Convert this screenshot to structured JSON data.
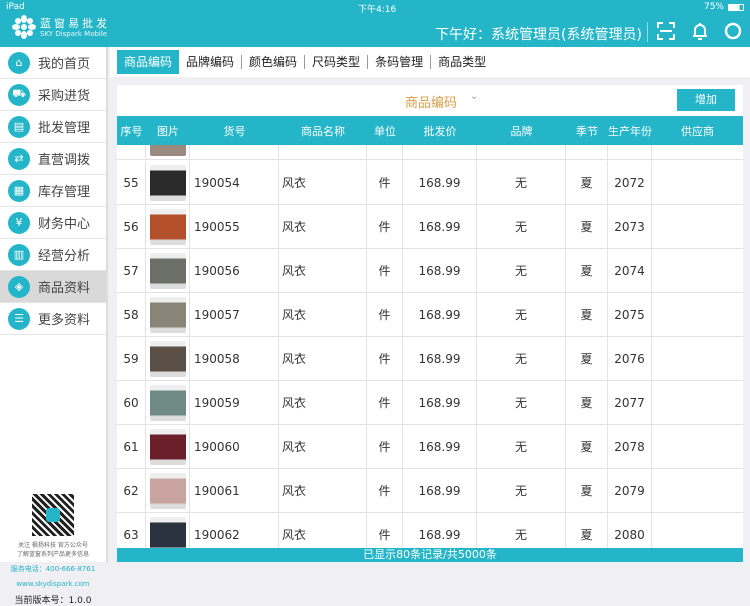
{
  "status_bar": {
    "device": "iPad",
    "time": "下午4:16",
    "battery": "75%"
  },
  "header": {
    "brand_cn": "蓝窗易批发",
    "brand_en": "SKY Dispark Mobile",
    "greeting": "下午好：系统管理员(系统管理员)"
  },
  "sidebar": {
    "items": [
      {
        "label": "我的首页",
        "icon": "home-icon"
      },
      {
        "label": "采购进货",
        "icon": "truck-icon"
      },
      {
        "label": "批发管理",
        "icon": "wholesale-icon"
      },
      {
        "label": "直营调拨",
        "icon": "transfer-icon"
      },
      {
        "label": "库存管理",
        "icon": "inventory-icon"
      },
      {
        "label": "财务中心",
        "icon": "yen-icon"
      },
      {
        "label": "经营分析",
        "icon": "chart-icon"
      },
      {
        "label": "商品资料",
        "icon": "bag-icon",
        "selected": true
      },
      {
        "label": "更多资料",
        "icon": "list-icon"
      }
    ],
    "follow": "关注 枫杨科技 官方公众号",
    "follow2": "了解蓝窗系列产品更多信息",
    "phone": "服务电话：400-666-8761",
    "website": "www.skydispark.com",
    "version": "当前版本号：1.0.0"
  },
  "tabs": [
    "商品编码",
    "品牌编码",
    "颜色编码",
    "尺码类型",
    "条码管理",
    "商品类型"
  ],
  "panel": {
    "title": "商品编码",
    "add_label": "增加"
  },
  "table": {
    "headers": [
      "序号",
      "图片",
      "货号",
      "商品名称",
      "单位",
      "批发价",
      "品牌",
      "季节",
      "生产年份",
      "供应商"
    ],
    "rows": [
      {
        "no": "55",
        "code": "190054",
        "name": "风衣",
        "unit": "件",
        "price": "168.99",
        "brand": "无",
        "season": "夏",
        "year": "2072",
        "supplier": "",
        "color": "#2a2a2a"
      },
      {
        "no": "56",
        "code": "190055",
        "name": "风衣",
        "unit": "件",
        "price": "168.99",
        "brand": "无",
        "season": "夏",
        "year": "2073",
        "supplier": "",
        "color": "#b4502c"
      },
      {
        "no": "57",
        "code": "190056",
        "name": "风衣",
        "unit": "件",
        "price": "168.99",
        "brand": "无",
        "season": "夏",
        "year": "2074",
        "supplier": "",
        "color": "#6d7068"
      },
      {
        "no": "58",
        "code": "190057",
        "name": "风衣",
        "unit": "件",
        "price": "168.99",
        "brand": "无",
        "season": "夏",
        "year": "2075",
        "supplier": "",
        "color": "#8a8478"
      },
      {
        "no": "59",
        "code": "190058",
        "name": "风衣",
        "unit": "件",
        "price": "168.99",
        "brand": "无",
        "season": "夏",
        "year": "2076",
        "supplier": "",
        "color": "#5a5048"
      },
      {
        "no": "60",
        "code": "190059",
        "name": "风衣",
        "unit": "件",
        "price": "168.99",
        "brand": "无",
        "season": "夏",
        "year": "2077",
        "supplier": "",
        "color": "#6f8a84"
      },
      {
        "no": "61",
        "code": "190060",
        "name": "风衣",
        "unit": "件",
        "price": "168.99",
        "brand": "无",
        "season": "夏",
        "year": "2078",
        "supplier": "",
        "color": "#6a1f2a"
      },
      {
        "no": "62",
        "code": "190061",
        "name": "风衣",
        "unit": "件",
        "price": "168.99",
        "brand": "无",
        "season": "夏",
        "year": "2079",
        "supplier": "",
        "color": "#c9a3a0"
      },
      {
        "no": "63",
        "code": "190062",
        "name": "风衣",
        "unit": "件",
        "price": "168.99",
        "brand": "无",
        "season": "夏",
        "year": "2080",
        "supplier": "",
        "color": "#2b3340"
      }
    ]
  },
  "footer": "已显示80条记录/共5000条",
  "colors": {
    "accent": "#25b5c9",
    "title": "#d6a04a"
  }
}
